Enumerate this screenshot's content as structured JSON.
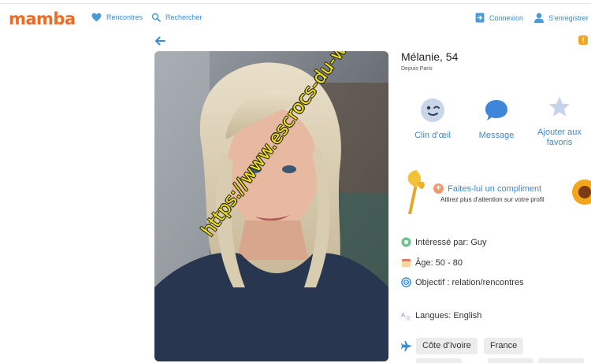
{
  "header": {
    "logo": "mamba",
    "nav_left": [
      {
        "label": "Rencontres",
        "icon": "heart-icon"
      },
      {
        "label": "Rechercher",
        "icon": "search-icon"
      }
    ],
    "nav_right": [
      {
        "label": "Connexion",
        "icon": "login-icon"
      },
      {
        "label": "S'enregistrer",
        "icon": "user-icon"
      }
    ]
  },
  "profile": {
    "name": "Mélanie, 54",
    "location": "Depuis Paris",
    "watermark": "https://www.escrocs-du-web.fr"
  },
  "actions": [
    {
      "label": "Clin d’œil",
      "icon": "wink-icon"
    },
    {
      "label": "Message",
      "icon": "message-icon"
    },
    {
      "label": "Ajouter aux favoris",
      "icon": "star-icon"
    }
  ],
  "compliment": {
    "title": "Faites-lui un compliment",
    "subtitle": "Attirez plus d’attention sur votre profil"
  },
  "details": {
    "interested": "Intéressé par: Guy",
    "age": "Âge: 50 - 80",
    "objective": "Objectif : relation/rencontres",
    "languages": "Langues: English"
  },
  "places": [
    "Côte d’Ivoire",
    "France"
  ],
  "colors": {
    "brand": "#f26a21",
    "link": "#3a8bd0",
    "chip_bg": "#ececec"
  }
}
